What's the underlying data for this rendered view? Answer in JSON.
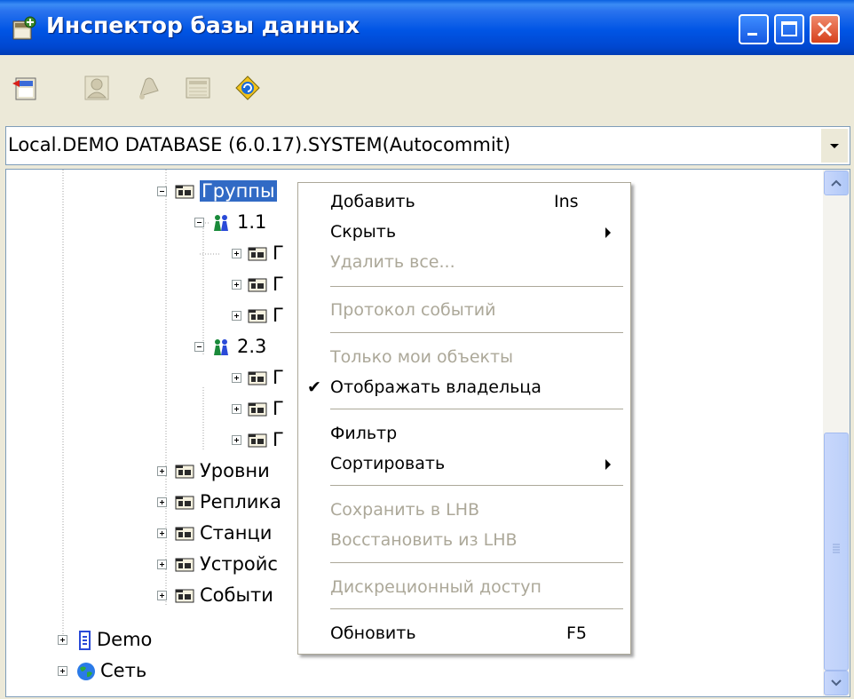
{
  "window": {
    "title": "Инспектор базы данных",
    "icon": "app-icon",
    "caption_buttons": [
      "minimize-icon",
      "maximize-icon",
      "close-icon"
    ]
  },
  "toolbar": {
    "buttons": [
      {
        "icon": "add-icon",
        "enabled": true
      },
      {
        "icon": "user-icon",
        "enabled": false
      },
      {
        "icon": "bell-icon",
        "enabled": false
      },
      {
        "icon": "list-icon",
        "enabled": false
      },
      {
        "icon": "refresh-icon",
        "enabled": true
      }
    ]
  },
  "connection": {
    "value": "Local.DEMO DATABASE (6.0.17).SYSTEM(Autocommit)"
  },
  "tree": {
    "items": [
      {
        "label": "Группы",
        "icon": "folder-icon",
        "expanded": true,
        "selected": true
      },
      {
        "label": "1.1",
        "icon": "group-icon",
        "expanded": true
      },
      {
        "label": "Г",
        "icon": "folder-icon"
      },
      {
        "label": "Г",
        "icon": "folder-icon"
      },
      {
        "label": "Г",
        "icon": "folder-icon"
      },
      {
        "label": "2.3",
        "icon": "group-icon",
        "expanded": true
      },
      {
        "label": "Г",
        "icon": "folder-icon"
      },
      {
        "label": "Г",
        "icon": "folder-icon"
      },
      {
        "label": "Г",
        "icon": "folder-icon"
      },
      {
        "label": "Уровни",
        "icon": "folder-icon"
      },
      {
        "label": "Реплика",
        "icon": "folder-icon"
      },
      {
        "label": "Станци",
        "icon": "folder-icon"
      },
      {
        "label": "Устройс",
        "icon": "folder-icon"
      },
      {
        "label": "Событи",
        "icon": "folder-icon"
      },
      {
        "label": "Demo",
        "icon": "database-icon"
      },
      {
        "label": "Сеть",
        "icon": "globe-icon"
      }
    ]
  },
  "context_menu": {
    "items": [
      {
        "label": "Добавить",
        "shortcut": "Ins",
        "enabled": true
      },
      {
        "label": "Скрыть",
        "submenu": true,
        "enabled": true
      },
      {
        "label": "Удалить все...",
        "enabled": false
      },
      {
        "label": "Протокол событий",
        "enabled": false
      },
      {
        "label": "Только мои объекты",
        "enabled": false
      },
      {
        "label": "Отображать владельца",
        "checked": true,
        "enabled": true
      },
      {
        "label": "Фильтр",
        "enabled": true
      },
      {
        "label": "Сортировать",
        "submenu": true,
        "enabled": true
      },
      {
        "label": "Сохранить в LHB",
        "enabled": false
      },
      {
        "label": "Восстановить из LHB",
        "enabled": false
      },
      {
        "label": "Дискреционный доступ",
        "enabled": false
      },
      {
        "label": "Обновить",
        "shortcut": "F5",
        "enabled": true
      }
    ]
  },
  "colors": {
    "titlebar": "#0055e5",
    "selection": "#316ac5",
    "disabled_text": "#aca899",
    "window_bg": "#ece9d8"
  }
}
